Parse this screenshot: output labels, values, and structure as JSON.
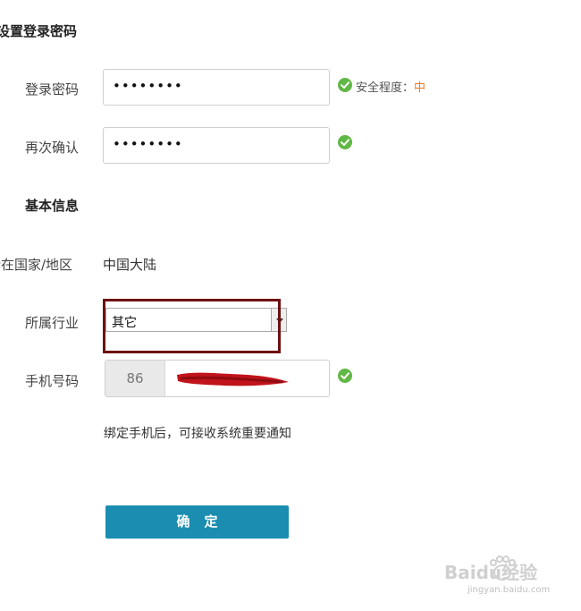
{
  "password_section": {
    "title": "设置登录密码",
    "password": {
      "label": "登录密码",
      "masked_value": "••••••••",
      "strength_prefix": "安全程度：",
      "strength_level": "中"
    },
    "confirm": {
      "label": "再次确认",
      "masked_value": "••••••••"
    }
  },
  "basic_info": {
    "title": "基本信息",
    "country": {
      "label": "所在国家/地区",
      "value": "中国大陆"
    },
    "industry": {
      "label": "所属行业",
      "selected": "其它"
    },
    "phone": {
      "label": "手机号码",
      "country_code": "86",
      "hint": "绑定手机后，可接收系统重要通知"
    }
  },
  "submit": {
    "label": "确定"
  },
  "watermark": {
    "brand": "Baidu经验",
    "url": "jingyan.baidu.com"
  },
  "colors": {
    "accent": "#1a8db0",
    "success": "#61b846",
    "strength_medium": "#ec7a22",
    "highlight_box": "#6e1010",
    "redaction": "#c0141a"
  },
  "icons": {
    "valid": "check-circle-icon",
    "dropdown": "chevron-down-icon"
  }
}
